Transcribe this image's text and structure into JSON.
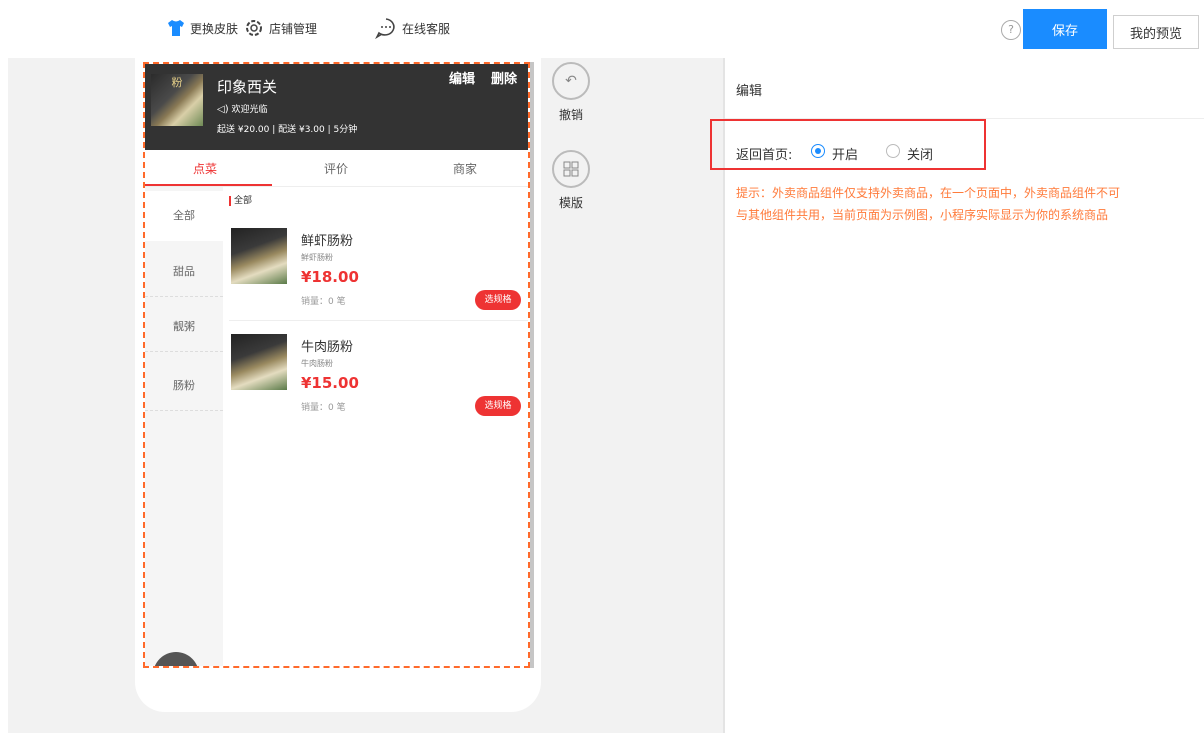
{
  "toolbar": {
    "skin_label": "更换皮肤",
    "store_label": "店铺管理",
    "service_label": "在线客服",
    "help_label": "?",
    "save_label": "保存",
    "preview_label": "我的预览"
  },
  "shop": {
    "logo_text": "粉",
    "name": "印象西关",
    "notice": "欢迎光临",
    "delivery_info": "起送 ¥20.00 | 配送 ¥3.00 | 5分钟",
    "edit_label": "编辑",
    "delete_label": "删除"
  },
  "tabs": [
    "点菜",
    "评价",
    "商家"
  ],
  "categories": [
    "全部",
    "甜品",
    "靓粥",
    "肠粉"
  ],
  "section_label": "全部",
  "items": [
    {
      "name": "鲜虾肠粉",
      "subtitle": "鲜虾肠粉",
      "price": "¥18.00",
      "sales": "销量：0 笔",
      "button": "选规格"
    },
    {
      "name": "牛肉肠粉",
      "subtitle": "牛肉肠粉",
      "price": "¥15.00",
      "sales": "销量：0 笔",
      "button": "选规格"
    }
  ],
  "side_tools": {
    "undo_label": "撤销",
    "template_label": "模版"
  },
  "panel": {
    "title": "编辑",
    "field_label": "返回首页:",
    "option_on": "开启",
    "option_off": "关闭",
    "selected": "开启",
    "tip_line1": "提示：外卖商品组件仅支持外卖商品，在一个页面中，外卖商品组件不可",
    "tip_line2": "与其他组件共用，当前页面为示例图，小程序实际显示为你的系统商品"
  },
  "colors": {
    "accent": "#1a8cff",
    "price_red": "#e33333",
    "tip_orange": "#ff7a3a",
    "dashed_border": "#ff6a2b",
    "shop_header_bg": "#333333"
  }
}
